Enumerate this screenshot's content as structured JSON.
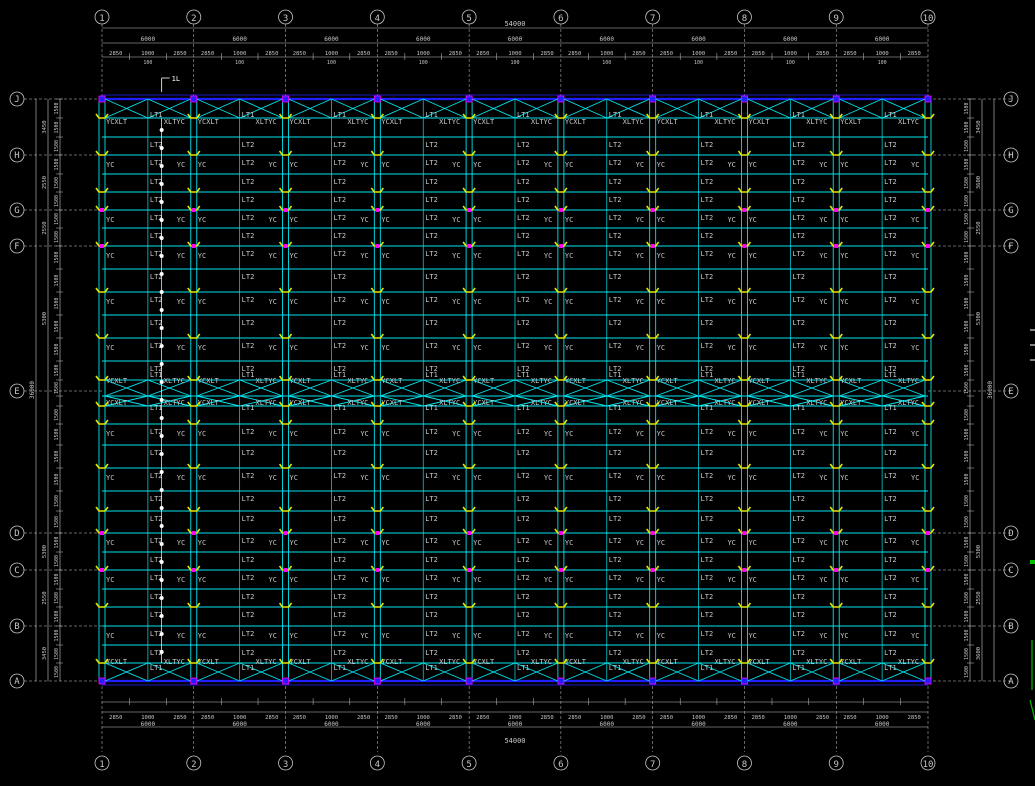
{
  "axes": {
    "columns": [
      "1",
      "2",
      "3",
      "4",
      "5",
      "6",
      "7",
      "8",
      "9",
      "10"
    ],
    "rows": [
      "J",
      "H",
      "G",
      "F",
      "E",
      "D",
      "C",
      "B",
      "A"
    ]
  },
  "dimensions": {
    "total_width": "54000",
    "bay": "6000",
    "sub": [
      "2850",
      "1000",
      "2850"
    ],
    "sub_mid": "100",
    "total_depth": "36000",
    "row_spacings_left": [
      "3450",
      "2550",
      "2550",
      "5300",
      "",
      "5300",
      "2550",
      "3450"
    ],
    "row_spacings_right": [
      "3450",
      "3600",
      "2550",
      "5300",
      "",
      "5300",
      "2550",
      "3600"
    ],
    "panel_sub": [
      "1500",
      "1500",
      "1500",
      "1500"
    ]
  },
  "labels": {
    "lt1": "LT1",
    "lt2": "LT2",
    "yc": "YC",
    "xlt": "XLT",
    "ycxlt": "YCXLT",
    "xltyc": "XLTYC",
    "marker": "1L"
  },
  "colors": {
    "background": "#000000",
    "member": "#00e5ee",
    "dim": "#c8c8c8",
    "yellow": "#e6e600",
    "blue": "#2020ff",
    "magenta": "#ff00ff",
    "green": "#00c000"
  }
}
